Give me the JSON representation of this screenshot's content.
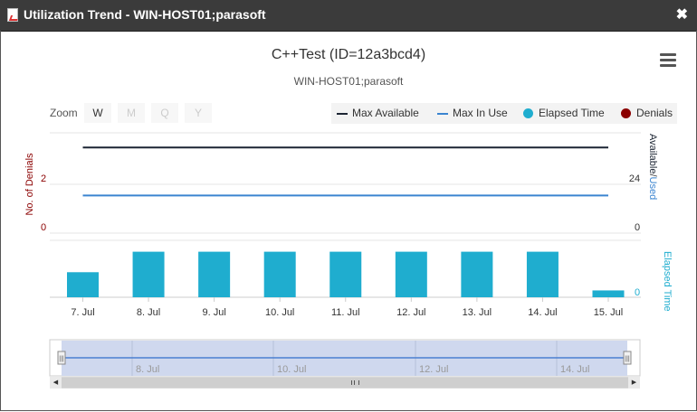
{
  "window": {
    "title": "Utilization Trend - WIN-HOST01;parasoft",
    "close_glyph": "✖"
  },
  "chart": {
    "title": "C++Test (ID=12a3bcd4)",
    "subtitle": "WIN-HOST01;parasoft",
    "menu_icon": "hamburger-icon"
  },
  "zoom": {
    "label": "Zoom",
    "buttons": [
      "W",
      "M",
      "Q",
      "Y"
    ],
    "active": "W"
  },
  "legend": {
    "items": [
      {
        "label": "Max Available",
        "symbol": "line",
        "color": "#1c2533"
      },
      {
        "label": "Max In Use",
        "symbol": "line",
        "color": "#3a84d0"
      },
      {
        "label": "Elapsed Time",
        "symbol": "dot",
        "color": "#1fadcf"
      },
      {
        "label": "Denials",
        "symbol": "dot",
        "color": "#8b0000"
      }
    ]
  },
  "axes": {
    "denials_title": "No. of Denials",
    "denials_ticks": [
      "2",
      "0"
    ],
    "available_title_part1": "Available",
    "available_title_sep": "/",
    "available_title_part2": "Used",
    "available_ticks": [
      "24",
      "0"
    ],
    "elapsed_title": "Elapsed Time",
    "elapsed_ticks": [
      "0"
    ]
  },
  "chart_data": {
    "type": "line+bar",
    "categories": [
      "7. Jul",
      "8. Jul",
      "9. Jul",
      "10. Jul",
      "11. Jul",
      "12. Jul",
      "13. Jul",
      "14. Jul",
      "15. Jul"
    ],
    "series": [
      {
        "name": "Max Available",
        "type": "line",
        "values": [
          41,
          41,
          41,
          41,
          41,
          41,
          41,
          41,
          41
        ]
      },
      {
        "name": "Max In Use",
        "type": "line",
        "values": [
          18,
          18,
          18,
          18,
          18,
          18,
          18,
          18,
          18
        ]
      },
      {
        "name": "Elapsed Time",
        "type": "bar",
        "values": [
          0.55,
          1,
          1,
          1,
          1,
          1,
          1,
          1,
          0.15
        ]
      },
      {
        "name": "Denials",
        "type": "line",
        "values": []
      }
    ],
    "available_ylim": [
      0,
      48
    ],
    "denials_ylim": [
      0,
      4
    ],
    "elapsed_ylim": [
      0,
      1.25
    ],
    "colors": {
      "max_available": "#1c2533",
      "max_in_use": "#3a84d0",
      "elapsed": "#1fadcf",
      "denials": "#8b0000"
    }
  },
  "navigator": {
    "labels": [
      "8. Jul",
      "10. Jul",
      "12. Jul",
      "14. Jul"
    ],
    "handle_glyph": "|||",
    "scroll_left": "◀",
    "scroll_right": "▶",
    "scroll_grip": "|||"
  }
}
